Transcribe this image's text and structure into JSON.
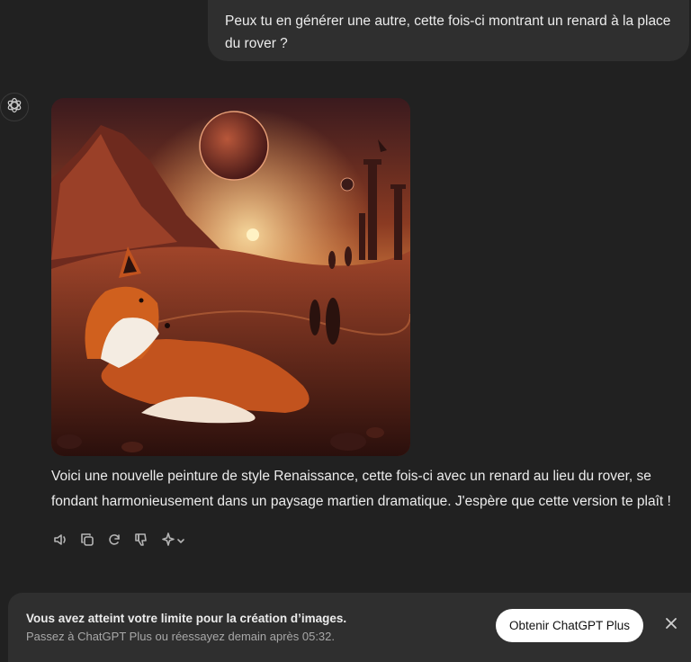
{
  "conversation": {
    "user_message": "Peux tu en générer une autre, cette fois-ci montrant un renard à la place du rover ?",
    "assistant_reply": "Voici une nouvelle peinture de style Renaissance, cette fois-ci avec un renard au lieu du rover, se fondant harmonieusement dans un paysage martien dramatique. J'espère que cette version te plaît !",
    "image_icon": "generated-image-fox-mars",
    "actions": [
      "speaker-icon",
      "copy-icon",
      "regenerate-icon",
      "thumbs-down-icon",
      "sparkle-model-icon"
    ]
  },
  "limit_banner": {
    "title": "Vous avez atteint votre limite pour la création d’images.",
    "subtitle": "Passez à ChatGPT Plus ou réessayez demain après 05:32.",
    "upgrade_label": "Obtenir ChatGPT Plus",
    "close_icon": "close-icon"
  },
  "colors": {
    "background": "#212121",
    "bubble": "#2f2f2f",
    "text": "#ececec",
    "muted": "#a8a8a8"
  }
}
